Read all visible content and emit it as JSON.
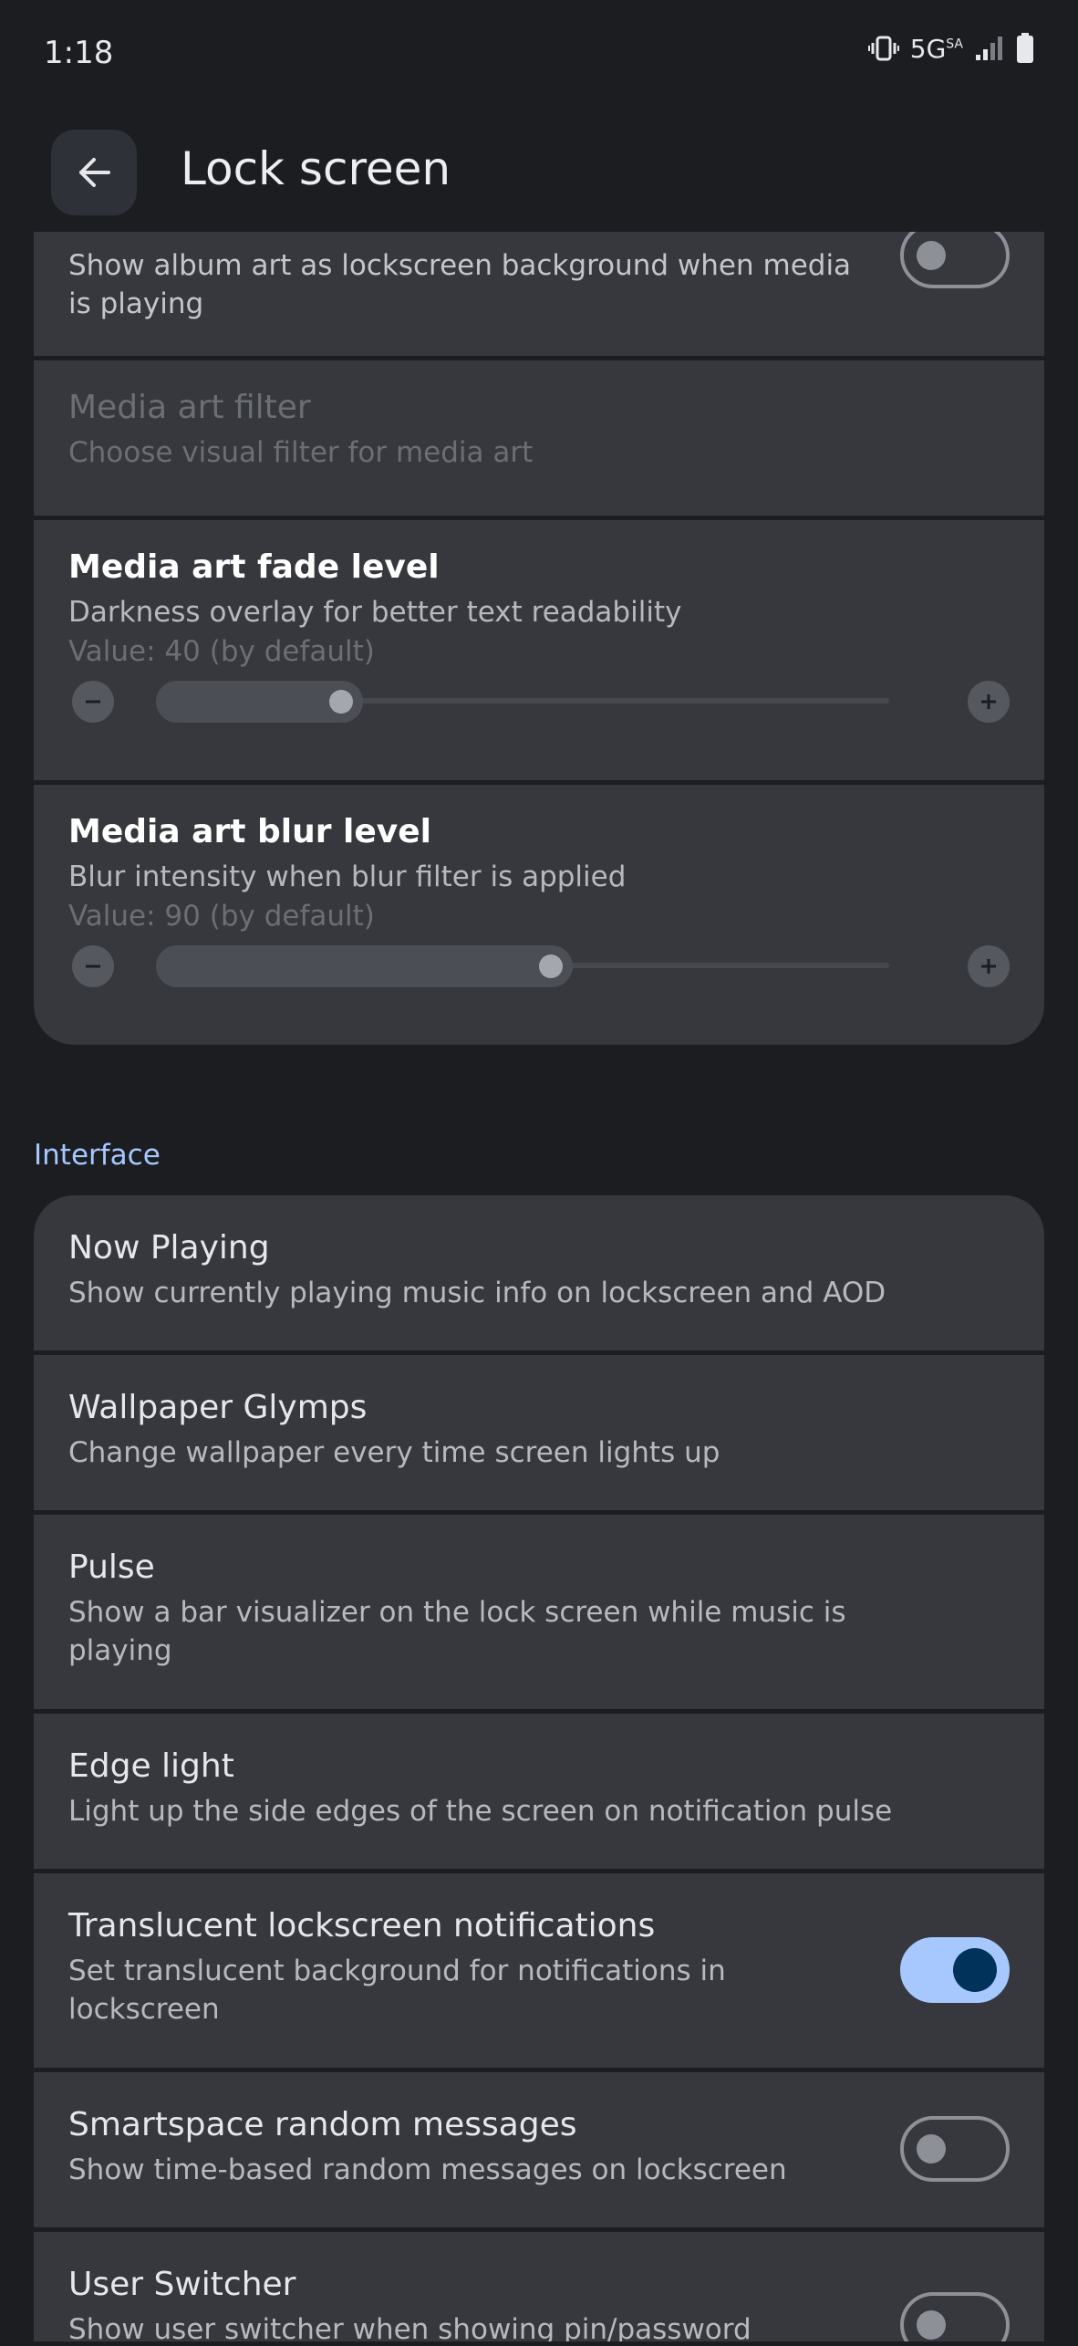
{
  "status_bar": {
    "time": "1:18",
    "network": "5G",
    "network_sup": "SA"
  },
  "header": {
    "title": "Lock screen"
  },
  "media_section": {
    "album_art": {
      "summary": "Show album art as lockscreen background when media is playing",
      "enabled": false
    },
    "media_art_filter": {
      "title": "Media art filter",
      "summary": "Choose visual filter for media art",
      "enabled": false
    },
    "fade_level": {
      "title": "Media art fade level",
      "summary": "Darkness overlay for better text readability",
      "value_text": "Value: 40 (by default)",
      "value": 40,
      "max": 100
    },
    "blur_level": {
      "title": "Media art blur level",
      "summary": "Blur intensity when blur filter is applied",
      "value_text": "Value: 90 (by default)",
      "value": 90,
      "max": 100
    }
  },
  "interface_section": {
    "label": "Interface",
    "items": [
      {
        "title": "Now Playing",
        "summary": "Show currently playing music info on lockscreen and AOD"
      },
      {
        "title": "Wallpaper Glymps",
        "summary": "Change wallpaper every time screen lights up"
      },
      {
        "title": "Pulse",
        "summary": "Show a bar visualizer on the lock screen while music is playing"
      },
      {
        "title": "Edge light",
        "summary": "Light up the side edges of the screen on notification pulse"
      },
      {
        "title": "Translucent lockscreen notifications",
        "summary": "Set translucent background for notifications in lockscreen",
        "toggle": true
      },
      {
        "title": "Smartspace random messages",
        "summary": "Show time-based random messages on lockscreen",
        "toggle": false
      },
      {
        "title": "User Switcher",
        "summary": "Show user switcher when showing pin/password",
        "toggle": false
      }
    ]
  },
  "colors": {
    "accent": "#a6c8ff",
    "surface": "#36383e",
    "background": "#1b1d21"
  },
  "icons": {
    "back": "arrow-left-icon",
    "minus": "minus-icon",
    "plus": "plus-icon",
    "vibrate": "vibrate-icon",
    "signal": "signal-icon",
    "battery": "battery-icon"
  }
}
